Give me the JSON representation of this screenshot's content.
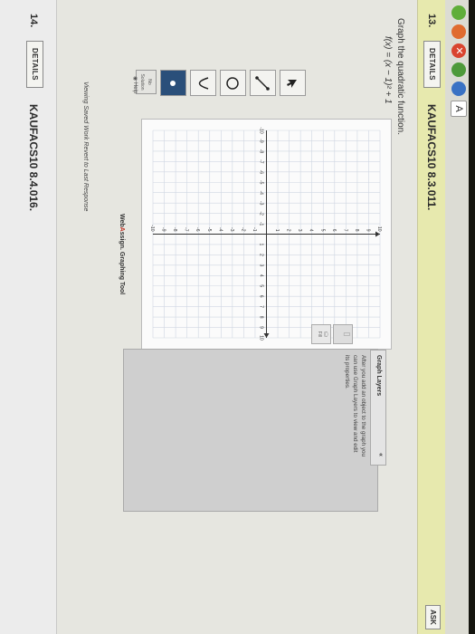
{
  "browser": {
    "tab_letter": "A"
  },
  "question13": {
    "number": "13.",
    "details_label": "DETAILS",
    "code": "KAUFACS10 8.3.011.",
    "ask_label": "ASK",
    "prompt": "Graph the quadratic function.",
    "function": "f(x) = (x − 1)² + 1"
  },
  "graph": {
    "x_min": -10,
    "x_max": 10,
    "y_min": -10,
    "y_max": 10,
    "x_ticks": [
      -10,
      -9,
      -8,
      -7,
      -6,
      -5,
      -4,
      -3,
      -2,
      -1,
      1,
      2,
      3,
      4,
      5,
      6,
      7,
      8,
      9,
      10
    ],
    "y_ticks": [
      -10,
      -9,
      -8,
      -7,
      -6,
      -5,
      -4,
      -3,
      -2,
      -1,
      1,
      2,
      3,
      4,
      5,
      6,
      7,
      8,
      9,
      10
    ],
    "x_tick_labels": [
      "-10",
      "-9",
      "-8",
      "-7",
      "-6",
      "-5",
      "-4",
      "-3",
      "-2",
      "-1",
      "1",
      "2",
      "3",
      "4",
      "5",
      "6",
      "7",
      "8",
      "9",
      "10"
    ],
    "y_tick_labels": [
      "-10",
      "-9",
      "-8",
      "-7",
      "-6",
      "-5",
      "-4",
      "-3",
      "-2",
      "-1",
      "1",
      "2",
      "3",
      "4",
      "5",
      "6",
      "7",
      "8",
      "9",
      "10"
    ]
  },
  "tools": {
    "no_solution_line1": "No",
    "no_solution_line2": "Solution",
    "help_label": "Help"
  },
  "layers": {
    "title": "Graph Layers",
    "collapse_icon": "«",
    "description": "After you add an object to the graph you can use Graph Layers to view and edit its properties.",
    "fill_label": "Fill"
  },
  "footer": {
    "logo_prefix": "Web",
    "logo_highlight": "A",
    "logo_suffix": "ssign. Graphing Tool",
    "viewing_text": "Viewing Saved Work Revert to Last Response"
  },
  "question14": {
    "number": "14.",
    "details_label": "DETAILS",
    "code": "KAUFACS10 8.4.016."
  },
  "colors": {
    "header_bg": "#e7e9ae",
    "tool_selected": "#2a4f7a",
    "function_red": "#c0392b"
  }
}
